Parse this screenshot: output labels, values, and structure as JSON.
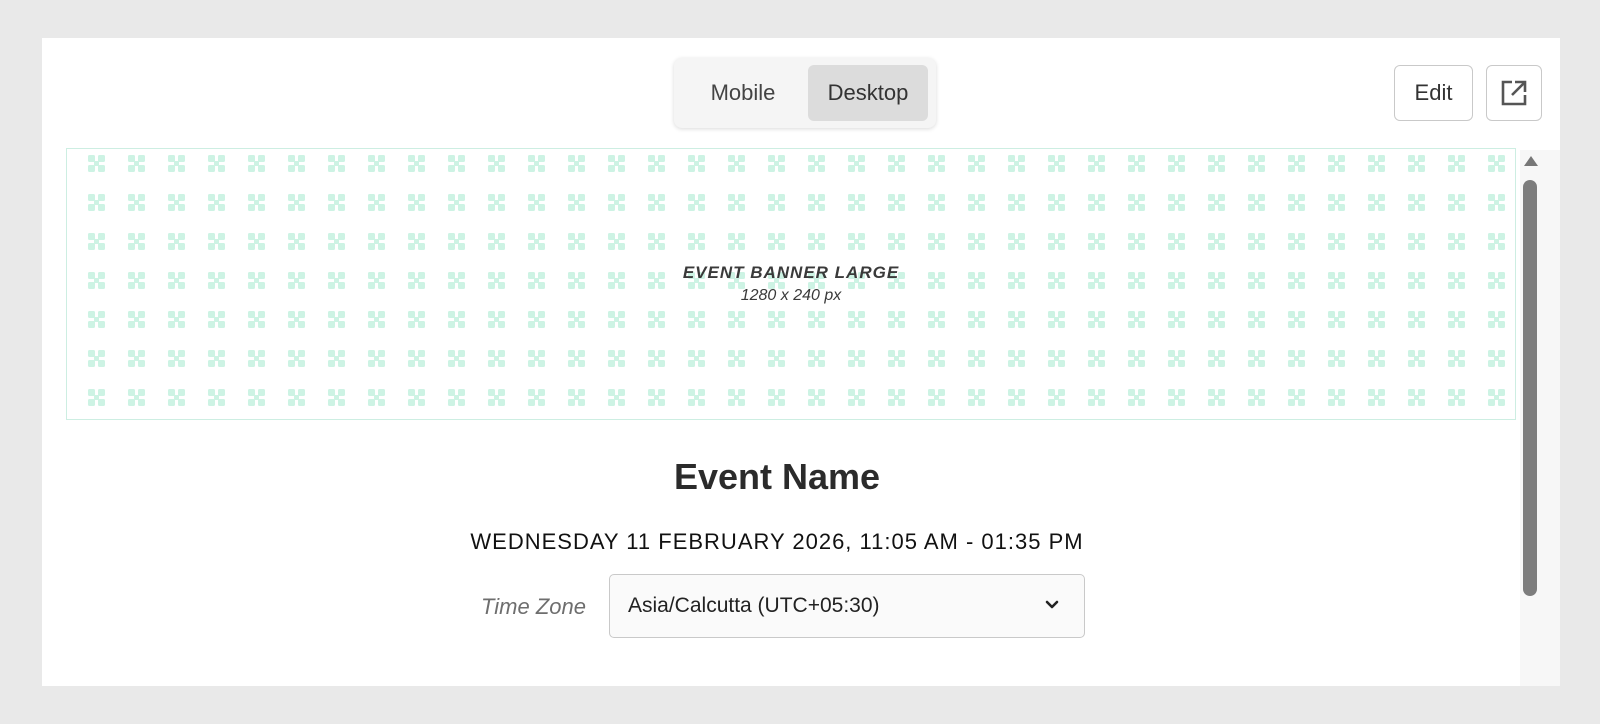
{
  "view_toggle": {
    "mobile_label": "Mobile",
    "desktop_label": "Desktop",
    "selected": "Desktop"
  },
  "toolbar": {
    "edit_label": "Edit",
    "open_icon": "external-link-icon"
  },
  "banner": {
    "title": "EVENT BANNER LARGE",
    "size_text": "1280 x 240 px",
    "pattern_color": "#cdf3e4"
  },
  "event": {
    "name": "Event Name",
    "datetime": "WEDNESDAY 11 FEBRUARY 2026, 11:05 AM - 01:35 PM",
    "timezone_label": "Time Zone",
    "timezone_value": "Asia/Calcutta (UTC+05:30)"
  },
  "colors": {
    "page_bg": "#e9e9e9",
    "selected_segment": "#dcdcdc",
    "scrollbar_thumb": "#7d7d7d"
  }
}
